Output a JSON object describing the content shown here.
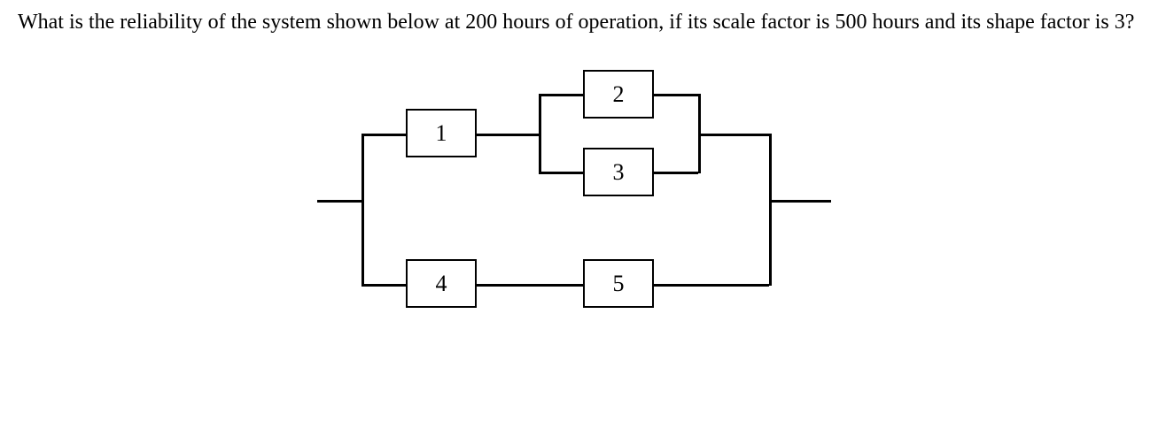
{
  "question": {
    "text": "What is the reliability of the system shown below at 200 hours of operation, if its scale factor is 500 hours and its shape factor is 3?"
  },
  "diagram": {
    "blocks": {
      "b1": "1",
      "b2": "2",
      "b3": "3",
      "b4": "4",
      "b5": "5"
    }
  }
}
